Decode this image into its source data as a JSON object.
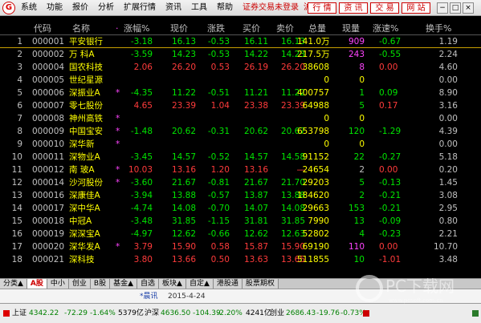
{
  "menu": {
    "items": [
      "系统",
      "功能",
      "报价",
      "分析",
      "扩展行情",
      "资讯",
      "工具",
      "帮助"
    ],
    "notice": "证券交易未登录",
    "market": "沪深A",
    "buttons": [
      "行 情",
      "资 讯",
      "交 易",
      "网 站"
    ]
  },
  "columns": [
    "代码",
    "名称",
    "·",
    "涨幅%",
    "现价",
    "涨跌",
    "买价",
    "卖价",
    "总量",
    "现量",
    "涨速%",
    "换手%"
  ],
  "rows": [
    {
      "num": "1",
      "code": "000001",
      "name": "平安银行",
      "star": "",
      "chg": "-3.18",
      "price": "16.13",
      "up": "-0.53",
      "bid": "16.11",
      "ask": "16.13",
      "vol": "141.0万",
      "cur": "909",
      "spd": "-0.67",
      "turn": "1.19",
      "dir": "down",
      "cur_color": "mag"
    },
    {
      "num": "2",
      "code": "000002",
      "name": "万 科A",
      "star": "",
      "chg": "-3.59",
      "price": "14.23",
      "up": "-0.53",
      "bid": "14.22",
      "ask": "14.23",
      "vol": "217.5万",
      "cur": "243",
      "spd": "-0.55",
      "turn": "2.24",
      "dir": "down",
      "cur_color": "mag"
    },
    {
      "num": "3",
      "code": "000004",
      "name": "国农科技",
      "star": "",
      "chg": "2.06",
      "price": "26.20",
      "up": "0.53",
      "bid": "26.19",
      "ask": "26.20",
      "vol": "38608",
      "cur": "8",
      "spd": "0.00",
      "turn": "4.60",
      "dir": "up",
      "cur_color": "mag"
    },
    {
      "num": "4",
      "code": "000005",
      "name": "世纪星源",
      "star": "",
      "chg": "",
      "price": "",
      "up": "",
      "bid": "",
      "ask": "",
      "vol": "0",
      "cur": "0",
      "spd": "",
      "turn": "0.00",
      "dir": "flat",
      "cur_color": ""
    },
    {
      "num": "5",
      "code": "000006",
      "name": "深振业A",
      "star": "*",
      "chg": "-4.35",
      "price": "11.22",
      "up": "-0.51",
      "bid": "11.21",
      "ask": "11.22",
      "vol": "400757",
      "cur": "1",
      "spd": "0.09",
      "turn": "8.90",
      "dir": "down",
      "cur_color": "grn"
    },
    {
      "num": "6",
      "code": "000007",
      "name": "零七股份",
      "star": "",
      "chg": "4.65",
      "price": "23.39",
      "up": "1.04",
      "bid": "23.38",
      "ask": "23.39",
      "vol": "64988",
      "cur": "5",
      "spd": "0.17",
      "turn": "3.16",
      "dir": "up",
      "cur_color": "grn"
    },
    {
      "num": "7",
      "code": "000008",
      "name": "神州高铁",
      "star": "*",
      "chg": "",
      "price": "",
      "up": "",
      "bid": "",
      "ask": "",
      "vol": "0",
      "cur": "0",
      "spd": "",
      "turn": "0.00",
      "dir": "flat",
      "cur_color": ""
    },
    {
      "num": "8",
      "code": "000009",
      "name": "中国宝安",
      "star": "*",
      "chg": "-1.48",
      "price": "20.62",
      "up": "-0.31",
      "bid": "20.62",
      "ask": "20.67",
      "vol": "653798",
      "cur": "120",
      "spd": "-1.29",
      "turn": "4.39",
      "dir": "down",
      "cur_color": "grn"
    },
    {
      "num": "9",
      "code": "000010",
      "name": "深华新",
      "star": "*",
      "chg": "",
      "price": "",
      "up": "",
      "bid": "",
      "ask": "",
      "vol": "0",
      "cur": "0",
      "spd": "",
      "turn": "0.00",
      "dir": "flat",
      "cur_color": ""
    },
    {
      "num": "10",
      "code": "000011",
      "name": "深物业A",
      "star": "",
      "chg": "-3.45",
      "price": "14.57",
      "up": "-0.52",
      "bid": "14.57",
      "ask": "14.58",
      "vol": "91152",
      "cur": "22",
      "spd": "-0.27",
      "turn": "5.18",
      "dir": "down",
      "cur_color": "grn"
    },
    {
      "num": "11",
      "code": "000012",
      "name": "南 玻A",
      "star": "*",
      "chg": "10.03",
      "price": "13.16",
      "up": "1.20",
      "bid": "13.16",
      "ask": "—",
      "vol": "24654",
      "cur": "2",
      "spd": "0.00",
      "turn": "0.20",
      "dir": "up",
      "cur_color": "wht"
    },
    {
      "num": "12",
      "code": "000014",
      "name": "沙河股份",
      "star": "*",
      "chg": "-3.60",
      "price": "21.67",
      "up": "-0.81",
      "bid": "21.67",
      "ask": "21.70",
      "vol": "29203",
      "cur": "5",
      "spd": "-0.13",
      "turn": "1.45",
      "dir": "down",
      "cur_color": "grn"
    },
    {
      "num": "13",
      "code": "000016",
      "name": "深康佳A",
      "star": "",
      "chg": "-3.94",
      "price": "13.88",
      "up": "-0.57",
      "bid": "13.87",
      "ask": "13.88",
      "vol": "184620",
      "cur": "2",
      "spd": "-0.21",
      "turn": "3.08",
      "dir": "down",
      "cur_color": "grn"
    },
    {
      "num": "14",
      "code": "000017",
      "name": "深中华A",
      "star": "",
      "chg": "-4.74",
      "price": "14.08",
      "up": "-0.70",
      "bid": "14.07",
      "ask": "14.08",
      "vol": "29663",
      "cur": "153",
      "spd": "-0.21",
      "turn": "2.95",
      "dir": "down",
      "cur_color": "grn"
    },
    {
      "num": "15",
      "code": "000018",
      "name": "中冠A",
      "star": "",
      "chg": "-3.48",
      "price": "31.85",
      "up": "-1.15",
      "bid": "31.81",
      "ask": "31.85",
      "vol": "7990",
      "cur": "13",
      "spd": "-0.09",
      "turn": "0.80",
      "dir": "down",
      "cur_color": "grn"
    },
    {
      "num": "16",
      "code": "000019",
      "name": "深深宝A",
      "star": "",
      "chg": "-4.97",
      "price": "12.62",
      "up": "-0.66",
      "bid": "12.62",
      "ask": "12.63",
      "vol": "52802",
      "cur": "4",
      "spd": "-0.23",
      "turn": "2.21",
      "dir": "down",
      "cur_color": "grn"
    },
    {
      "num": "17",
      "code": "000020",
      "name": "深华发A",
      "star": "*",
      "chg": "3.79",
      "price": "15.90",
      "up": "0.58",
      "bid": "15.87",
      "ask": "15.90",
      "vol": "69190",
      "cur": "110",
      "spd": "0.00",
      "turn": "10.70",
      "dir": "up",
      "cur_color": "mag"
    },
    {
      "num": "18",
      "code": "000021",
      "name": "深科技",
      "star": "",
      "chg": "3.80",
      "price": "13.66",
      "up": "0.50",
      "bid": "13.63",
      "ask": "13.65",
      "vol": "511855",
      "cur": "10",
      "spd": "-1.01",
      "turn": "3.48",
      "dir": "up",
      "cur_color": "grn"
    }
  ],
  "tabs": [
    "分类▲",
    "A股",
    "中小",
    "创业",
    "B股",
    "基金▲",
    "自选",
    "板块▲",
    "自定▲",
    "港股通",
    "股票期权"
  ],
  "news": {
    "label": "*晨讯",
    "date": "2015-4-24"
  },
  "status": {
    "sh_label": "上证",
    "sh_index": "4342.22",
    "sh_change": "-72.29",
    "sh_pct": "-1.64%",
    "sh_amount": "5379亿",
    "sz_label": "沪深",
    "sz_index": "4636.50",
    "sz_change": "-104.39",
    "sz_pct": "-2.20%",
    "sz_amount": "4241亿",
    "cy_label": "创业",
    "cy_index": "2686.43",
    "cy_change": "-19.76",
    "cy_pct": "-0.73%"
  },
  "watermark": {
    "title": "PC下载网",
    "url": "www.pcsoft.com.cn"
  }
}
